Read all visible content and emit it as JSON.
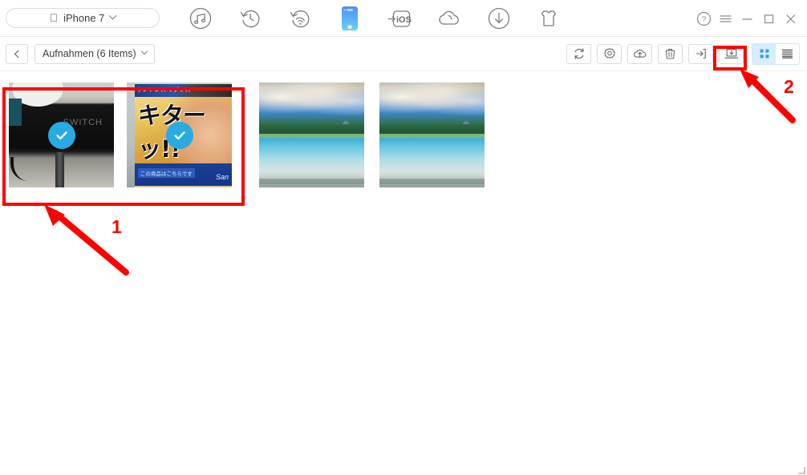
{
  "window": {
    "title": "iPhone 7",
    "controls": [
      {
        "name": "help-button",
        "label": "?"
      },
      {
        "name": "menu-button",
        "label": "≡"
      },
      {
        "name": "minimize-button",
        "label": "−"
      },
      {
        "name": "maximize-button",
        "label": "□"
      },
      {
        "name": "close-button",
        "label": "✕"
      }
    ]
  },
  "device_selector": {
    "brand_glyph": "",
    "device_name": "iPhone 7",
    "chevron": "chevron-down-icon"
  },
  "top_nav": {
    "items": [
      {
        "name": "music-manager-icon",
        "icon": "music-note-circle-icon",
        "active": false
      },
      {
        "name": "backup-restore-icon",
        "icon": "clock-rotate-left-icon",
        "active": false
      },
      {
        "name": "wireless-transfer-icon",
        "icon": "wifi-rotate-icon",
        "active": false
      },
      {
        "name": "device-manager-icon",
        "icon": "phone-icon",
        "active": true
      },
      {
        "name": "ios-transfer-icon",
        "icon": "to-ios-icon",
        "active": false
      },
      {
        "name": "cloud-icon",
        "icon": "cloud-icon",
        "active": false
      },
      {
        "name": "downloader-icon",
        "icon": "download-circle-icon",
        "active": false
      },
      {
        "name": "ringtone-maker-icon",
        "icon": "tshirt-icon",
        "active": false
      }
    ]
  },
  "sub_toolbar": {
    "back_label": "‹",
    "album": {
      "label": "Aufnahmen (6 Items)",
      "chevron": "chevron-down-icon"
    },
    "actions": [
      {
        "name": "refresh-button",
        "icon": "refresh-icon"
      },
      {
        "name": "settings-button",
        "icon": "gear-icon"
      },
      {
        "name": "upload-to-device-button",
        "icon": "cloud-upload-icon"
      },
      {
        "name": "delete-button",
        "icon": "trash-icon"
      },
      {
        "name": "export-to-device-button",
        "icon": "export-arrow-icon"
      },
      {
        "name": "export-to-computer-button",
        "icon": "export-to-pc-icon",
        "highlighted": true
      }
    ],
    "view_toggle": [
      {
        "name": "grid-view-button",
        "icon": "grid-icon",
        "active": true
      },
      {
        "name": "list-view-button",
        "icon": "list-icon",
        "active": false
      }
    ]
  },
  "photos": [
    {
      "name": "photo-thumbnail-1",
      "selected": true,
      "kind": "switch",
      "caption": "SWITCH"
    },
    {
      "name": "photo-thumbnail-2",
      "selected": true,
      "kind": "manga",
      "caption": "キターッ!!",
      "top_text": "サンドレス Vプラス",
      "bottom_text": "この商品はこちらです",
      "brand": "San"
    },
    {
      "name": "photo-thumbnail-3",
      "selected": false,
      "kind": "lake",
      "caption": ""
    },
    {
      "name": "photo-thumbnail-4",
      "selected": false,
      "kind": "lake",
      "caption": ""
    }
  ],
  "annotations": [
    {
      "name": "annotation-number-1",
      "label": "1"
    },
    {
      "name": "annotation-number-2",
      "label": "2"
    }
  ],
  "colors": {
    "accent_blue": "#29abe2",
    "selection_border": "#4ab6f0",
    "annotation_red": "#ff0000",
    "toggle_active_bg": "#d7edfb"
  }
}
